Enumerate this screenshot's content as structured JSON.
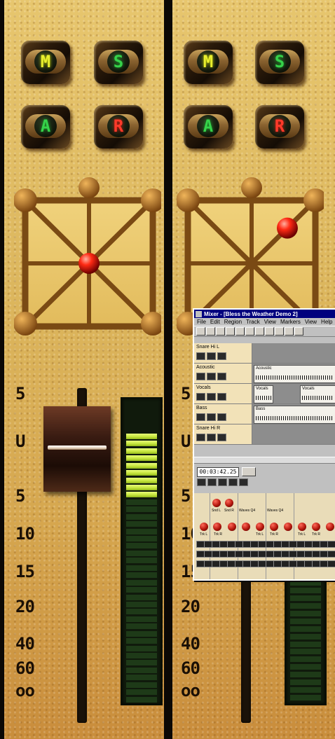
{
  "strip_buttons": [
    {
      "letter": "M",
      "color": "#e8ef2e",
      "role": "mute"
    },
    {
      "letter": "S",
      "color": "#36d24a",
      "role": "solo"
    },
    {
      "letter": "A",
      "color": "#36d24a",
      "role": "auto"
    },
    {
      "letter": "R",
      "color": "#ff3a2a",
      "role": "record"
    }
  ],
  "scale_labels": [
    "5",
    "U",
    "5",
    "10",
    "15",
    "20",
    "40",
    "60",
    "oo"
  ],
  "channels": [
    {
      "pan_x": 0.5,
      "pan_y": 0.5,
      "fader_level": "U",
      "meter_lit_segments": 9,
      "meter_total_segments": 37
    },
    {
      "pan_x": 0.78,
      "pan_y": 0.22
    }
  ],
  "window": {
    "title": "Mixer - [Bless the Weather Demo 2]",
    "menu": [
      "File",
      "Edit",
      "Region",
      "Track",
      "View",
      "Markers",
      "View",
      "Help"
    ],
    "tracks": [
      {
        "name": "Snare Hi L",
        "clip": ""
      },
      {
        "name": "Acoustic",
        "clip": "Acoustic"
      },
      {
        "name": "Vocals",
        "clip": "Vocals"
      },
      {
        "name": "Bass",
        "clip": "Bass"
      },
      {
        "name": "Snare Hi R",
        "clip": ""
      }
    ],
    "clip_extra": "Vocals",
    "time_display": "00:03:42.25",
    "mixer_labels": [
      "Snd L",
      "Snd R",
      "Waves Q4",
      "Waves Q4",
      "Trk L",
      "Trk R",
      "Trk L",
      "Trk R",
      "Trk L",
      "Trk R"
    ]
  },
  "colors": {
    "panel_gold": "#dcb65d",
    "meter_on": "#c2e23a",
    "window_title": "#00007e"
  }
}
